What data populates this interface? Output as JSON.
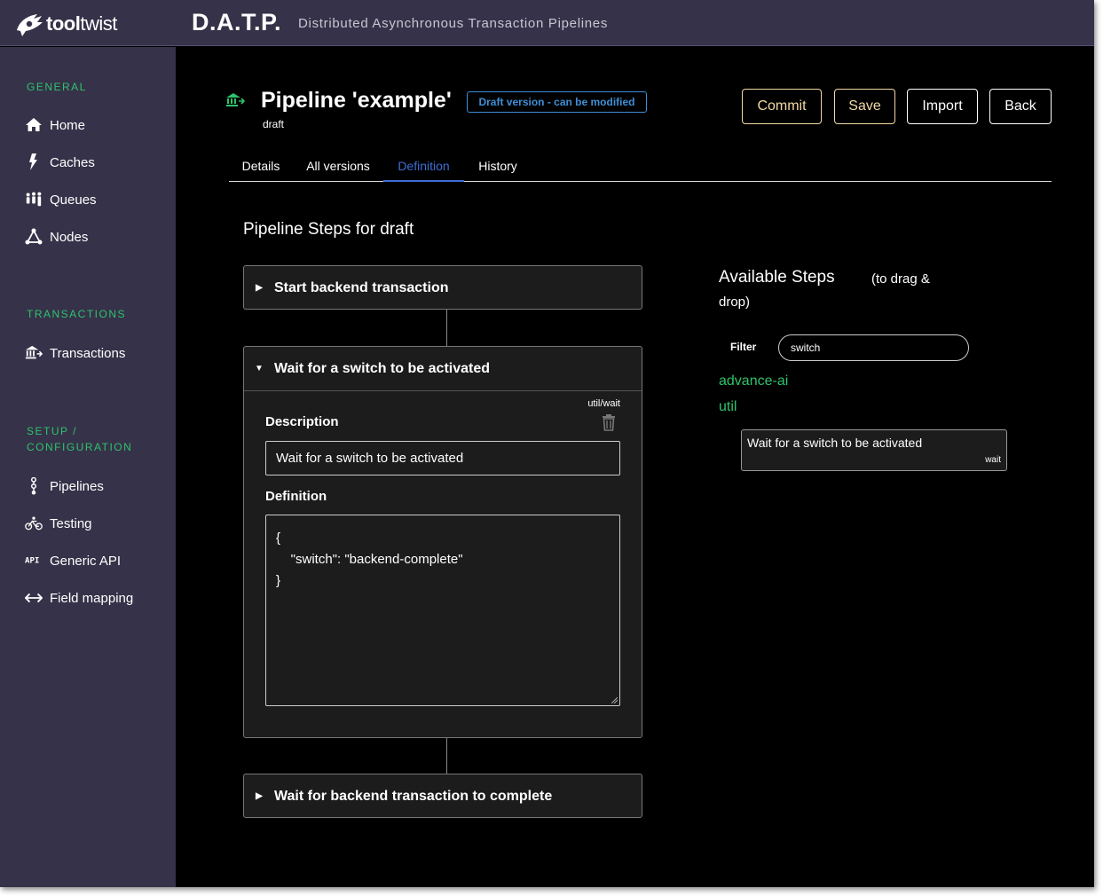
{
  "header": {
    "logo_bold": "tool",
    "logo_light": "twist",
    "app_title": "D.A.T.P.",
    "app_subtitle": "Distributed Asynchronous Transaction Pipelines"
  },
  "sidebar": {
    "sections": [
      {
        "title": "GENERAL",
        "items": [
          {
            "label": "Home",
            "icon": "home-icon"
          },
          {
            "label": "Caches",
            "icon": "lightning-icon"
          },
          {
            "label": "Queues",
            "icon": "people-queue-icon"
          },
          {
            "label": "Nodes",
            "icon": "nodes-icon"
          }
        ]
      },
      {
        "title": "TRANSACTIONS",
        "items": [
          {
            "label": "Transactions",
            "icon": "bank-icon"
          }
        ]
      },
      {
        "title_line1": "SETUP /",
        "title_line2": "CONFIGURATION",
        "items": [
          {
            "label": "Pipelines",
            "icon": "pipeline-icon"
          },
          {
            "label": "Testing",
            "icon": "bicycle-icon"
          },
          {
            "label": "Generic API",
            "icon": "api-icon"
          },
          {
            "label": "Field mapping",
            "icon": "arrows-horizontal-icon"
          }
        ]
      }
    ]
  },
  "page": {
    "title": "Pipeline 'example'",
    "subtitle": "draft",
    "badge": "Draft version - can be modified",
    "buttons": {
      "commit": "Commit",
      "save": "Save",
      "import": "Import",
      "back": "Back"
    },
    "tabs": [
      "Details",
      "All versions",
      "Definition",
      "History"
    ],
    "active_tab": "Definition"
  },
  "steps": {
    "title": "Pipeline Steps for draft",
    "items": [
      {
        "label": "Start backend transaction",
        "expanded": false
      },
      {
        "label": "Wait for a switch to be activated",
        "expanded": true,
        "type": "util/wait",
        "description_label": "Description",
        "description_value": "Wait for a switch to be activated",
        "definition_label": "Definition",
        "definition_value": "{\n    \"switch\": \"backend-complete\"\n}"
      },
      {
        "label": "Wait for backend transaction to complete",
        "expanded": false
      }
    ]
  },
  "available": {
    "title": "Available Steps",
    "hint_line1": "(to drag &",
    "hint_line2": "drop)",
    "filter_label": "Filter",
    "filter_value": "switch",
    "categories": [
      "advance-ai",
      "util"
    ],
    "cards": [
      {
        "label": "Wait for a switch to be activated",
        "type": "wait"
      }
    ]
  },
  "colors": {
    "sidebar_bg": "#363249",
    "accent_green": "#2ec36b",
    "accent_blue": "#3f6fd6",
    "button_gold": "#f3d9a4"
  }
}
